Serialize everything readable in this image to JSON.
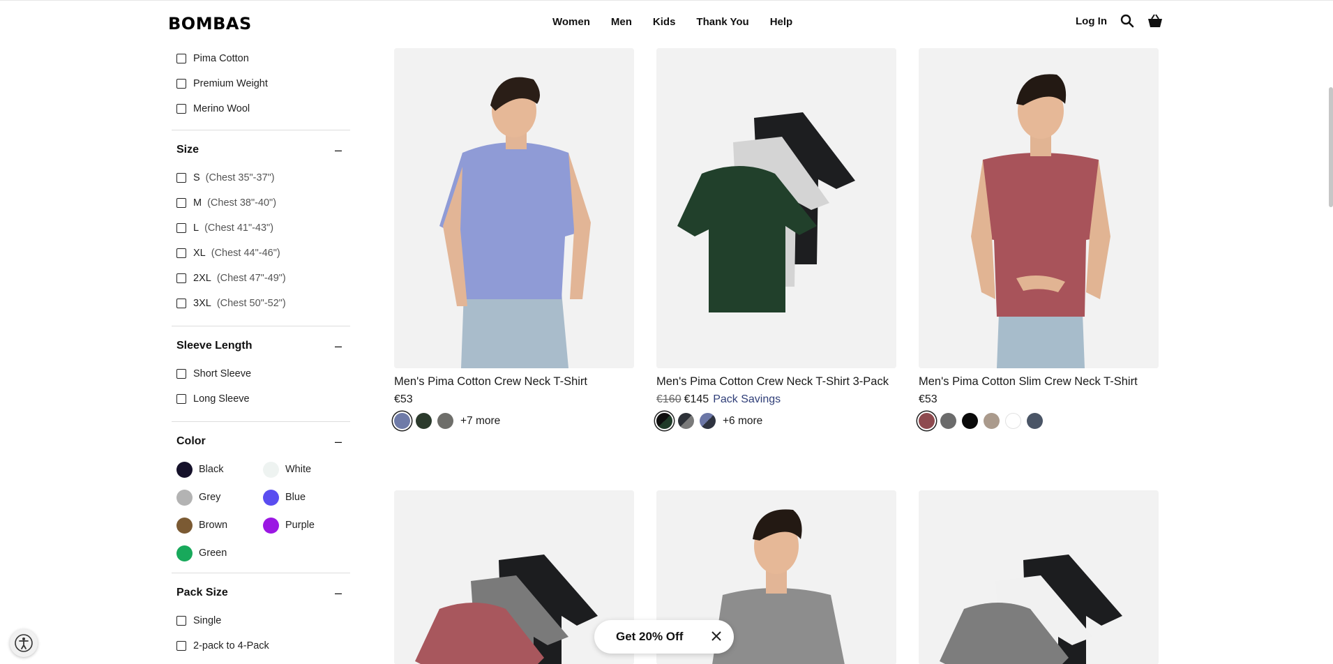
{
  "header": {
    "logo": "BOMBAS",
    "nav": [
      "Women",
      "Men",
      "Kids",
      "Thank You",
      "Help"
    ],
    "login": "Log In"
  },
  "sidebar": {
    "material_items": [
      "Pima Cotton",
      "Premium Weight",
      "Merino Wool"
    ],
    "size": {
      "title": "Size",
      "items": [
        {
          "label": "S",
          "hint": "(Chest 35\"-37\")"
        },
        {
          "label": "M",
          "hint": "(Chest 38\"-40\")"
        },
        {
          "label": "L",
          "hint": "(Chest 41\"-43\")"
        },
        {
          "label": "XL",
          "hint": "(Chest 44\"-46\")"
        },
        {
          "label": "2XL",
          "hint": "(Chest 47\"-49\")"
        },
        {
          "label": "3XL",
          "hint": "(Chest 50\"-52\")"
        }
      ]
    },
    "sleeve": {
      "title": "Sleeve Length",
      "items": [
        "Short Sleeve",
        "Long Sleeve"
      ]
    },
    "color": {
      "title": "Color",
      "items": [
        {
          "label": "Black",
          "hex": "#15112a"
        },
        {
          "label": "White",
          "hex": "#eef3f1"
        },
        {
          "label": "Grey",
          "hex": "#b3b3b3"
        },
        {
          "label": "Blue",
          "hex": "#5a4df0"
        },
        {
          "label": "Brown",
          "hex": "#7b5a33"
        },
        {
          "label": "Purple",
          "hex": "#9b17e3"
        },
        {
          "label": "Green",
          "hex": "#18a95b"
        }
      ]
    },
    "pack": {
      "title": "Pack Size",
      "items": [
        "Single",
        "2-pack to 4-Pack"
      ]
    },
    "collapse_symbol": "–"
  },
  "products": [
    {
      "title": "Men's Pima Cotton Crew Neck T-Shirt",
      "price": "€53",
      "swatches": [
        "#6f7ba8",
        "#2b3a2c",
        "#6e6e6a"
      ],
      "more": "+7 more"
    },
    {
      "title": "Men's Pima Cotton Crew Neck T-Shirt 3-Pack",
      "price_old": "€160",
      "price": "€145",
      "savings": "Pack Savings",
      "swatches": [
        "#1f3a28",
        "#6a6e6e",
        "#6b76a6"
      ],
      "more": "+6 more"
    },
    {
      "title": "Men's Pima Cotton Slim Crew Neck T-Shirt",
      "price": "€53",
      "swatches": [
        "#8e4a4f",
        "#6b6b6b",
        "#0a0a0a",
        "#aa9a8c",
        "#ffffff",
        "#4a5566"
      ],
      "more": ""
    }
  ],
  "promo": {
    "text": "Get 20% Off"
  }
}
